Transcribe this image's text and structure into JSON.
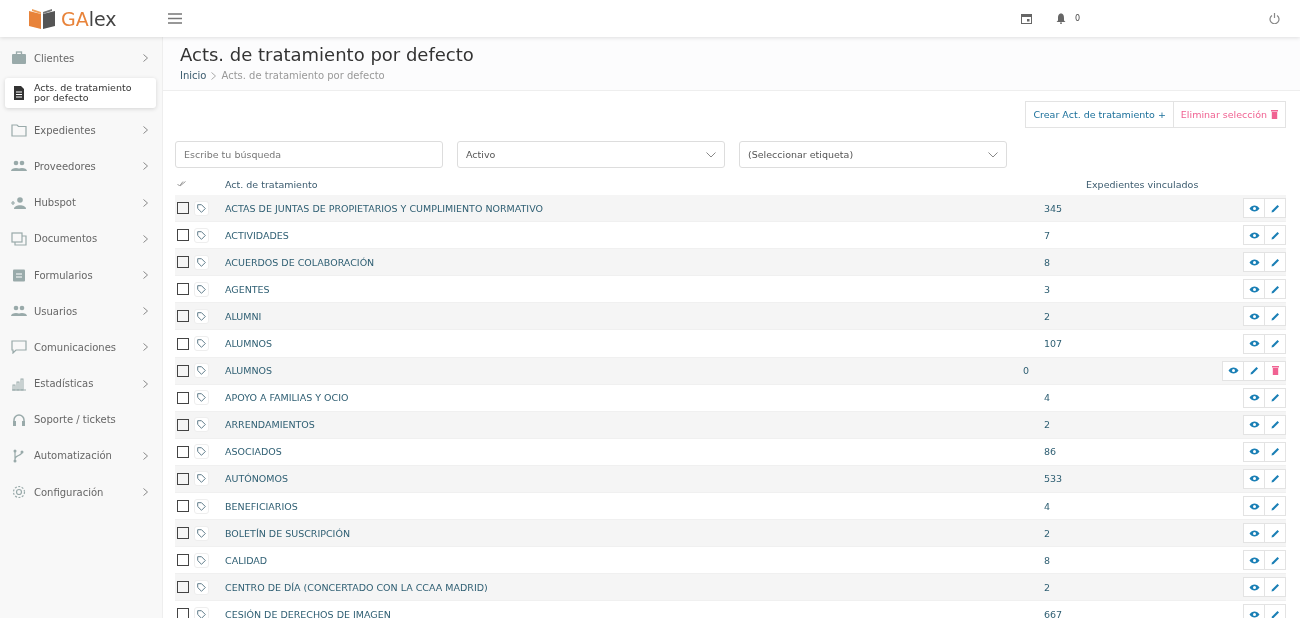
{
  "header": {
    "logo_text_accent": "GA",
    "logo_text": "lex",
    "notification_count": "0"
  },
  "sidebar": {
    "items": [
      {
        "label": "Clientes",
        "selected": false,
        "has_submenu": true
      },
      {
        "label": "Acts. de tratamiento por defecto",
        "selected": true,
        "has_submenu": false
      },
      {
        "label": "Expedientes",
        "selected": false,
        "has_submenu": true
      },
      {
        "label": "Proveedores",
        "selected": false,
        "has_submenu": true
      },
      {
        "label": "Hubspot",
        "selected": false,
        "has_submenu": true
      },
      {
        "label": "Documentos",
        "selected": false,
        "has_submenu": true
      },
      {
        "label": "Formularios",
        "selected": false,
        "has_submenu": true
      },
      {
        "label": "Usuarios",
        "selected": false,
        "has_submenu": true
      },
      {
        "label": "Comunicaciones",
        "selected": false,
        "has_submenu": true
      },
      {
        "label": "Estadísticas",
        "selected": false,
        "has_submenu": true
      },
      {
        "label": "Soporte / tickets",
        "selected": false,
        "has_submenu": false
      },
      {
        "label": "Automatización",
        "selected": false,
        "has_submenu": true
      },
      {
        "label": "Configuración",
        "selected": false,
        "has_submenu": true
      }
    ]
  },
  "page": {
    "title": "Acts. de tratamiento por defecto",
    "breadcrumb": [
      "Inicio",
      "Acts. de tratamiento por defecto"
    ]
  },
  "actions": {
    "create": "Crear Act. de tratamiento +",
    "delete": "Eliminar selección"
  },
  "filters": {
    "search": {
      "placeholder": "Escribe tu búsqueda"
    },
    "status": {
      "value": "Activo"
    },
    "tag": {
      "value": "(Seleccionar etiqueta)"
    }
  },
  "table": {
    "columns": [
      "Act. de tratamiento",
      "Expedientes vinculados"
    ],
    "rows": [
      {
        "name": "ACTAS DE JUNTAS DE PROPIETARIOS Y CUMPLIMIENTO NORMATIVO",
        "count": "345",
        "checked": false,
        "deletable": false
      },
      {
        "name": "ACTIVIDADES",
        "count": "7",
        "checked": false,
        "deletable": false
      },
      {
        "name": "ACUERDOS DE COLABORACIÓN",
        "count": "8",
        "checked": false,
        "deletable": false
      },
      {
        "name": "AGENTES",
        "count": "3",
        "checked": false,
        "deletable": false
      },
      {
        "name": "ALUMNI",
        "count": "2",
        "checked": false,
        "deletable": false
      },
      {
        "name": "ALUMNOS",
        "count": "107",
        "checked": false,
        "deletable": false
      },
      {
        "name": "ALUMNOS",
        "count": "0",
        "checked": false,
        "deletable": true
      },
      {
        "name": "APOYO A FAMILIAS Y OCIO",
        "count": "4",
        "checked": false,
        "deletable": false
      },
      {
        "name": "ARRENDAMIENTOS",
        "count": "2",
        "checked": false,
        "deletable": false
      },
      {
        "name": "ASOCIADOS",
        "count": "86",
        "checked": false,
        "deletable": false
      },
      {
        "name": "AUTÓNOMOS",
        "count": "533",
        "checked": false,
        "deletable": false
      },
      {
        "name": "BENEFICIARIOS",
        "count": "4",
        "checked": false,
        "deletable": false
      },
      {
        "name": "BOLETÍN DE SUSCRIPCIÓN",
        "count": "2",
        "checked": false,
        "deletable": false
      },
      {
        "name": "CALIDAD",
        "count": "8",
        "checked": false,
        "deletable": false
      },
      {
        "name": "CENTRO DE DÍA (CONCERTADO CON LA CCAA MADRID)",
        "count": "2",
        "checked": false,
        "deletable": false
      },
      {
        "name": "CESIÓN DE DERECHOS DE IMAGEN",
        "count": "667",
        "checked": false,
        "deletable": false
      }
    ]
  }
}
